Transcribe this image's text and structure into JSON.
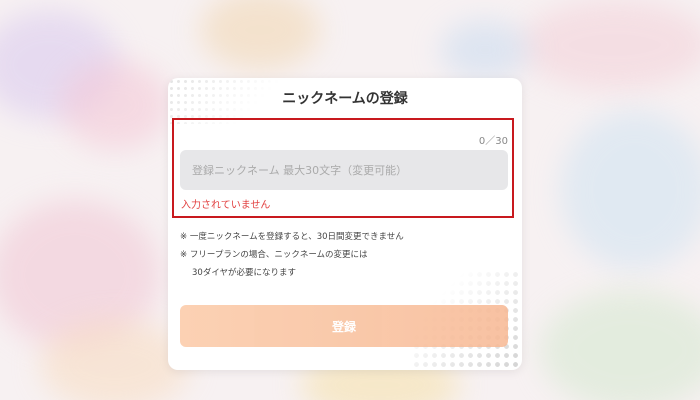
{
  "dialog": {
    "title": "ニックネームの登録",
    "counter": "0／30",
    "input_value": "",
    "input_placeholder": "登録ニックネーム 最大30文字（変更可能）",
    "error_message": "入力されていません",
    "notes": [
      "※ 一度ニックネームを登録すると、30日間変更できません",
      "※ フリープランの場合、ニックネームの変更には",
      "30ダイヤが必要になります"
    ],
    "submit_label": "登録"
  },
  "colors": {
    "highlight_border": "#c8191e",
    "error_text": "#e24141",
    "submit_gradient_start": "#fbc9a6",
    "submit_gradient_end": "#f7b792",
    "input_background": "#e7e7e9"
  }
}
